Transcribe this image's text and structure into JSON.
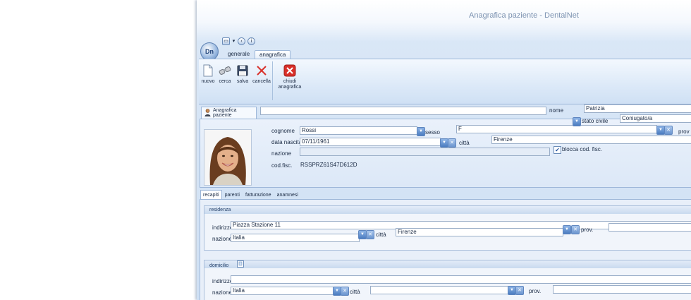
{
  "window": {
    "title": "Anagrafica paziente - DentalNet",
    "logo_text": "Dn"
  },
  "ribbon": {
    "tabs": [
      "generale",
      "anagrafica"
    ],
    "buttons": [
      {
        "label": "nuovo",
        "icon": "new-document-icon"
      },
      {
        "label": "cerca",
        "icon": "binoculars-icon"
      },
      {
        "label": "salva",
        "icon": "floppy-disk-icon"
      },
      {
        "label": "cancella",
        "icon": "delete-x-icon"
      }
    ],
    "close_button": {
      "label_line1": "chiudi",
      "label_line2": "anagrafica",
      "icon": "close-red-icon"
    }
  },
  "patient_tab": "Anagrafica paziente",
  "patient": {
    "nome_label": "nome",
    "nome": "Patrizia",
    "cognome_label": "cognome",
    "cognome": "Rossi",
    "data_nascita_label": "data nascita",
    "data_nascita": "07/11/1961",
    "nazione_label": "nazione",
    "nazione": "",
    "cod_fisc_label": "cod.fisc.",
    "cod_fisc": "RSSPRZ61S47D612D",
    "sesso_label": "sesso",
    "sesso": "F",
    "stato_civile_label": "stato civile",
    "stato_civile": "Coniugato/a",
    "prov_label": "prov",
    "citta_label": "città",
    "citta": "Firenze",
    "blocca_label": "blocca cod. fisc.",
    "blocca_checked": true
  },
  "subtabs": [
    "recapiti",
    "parenti",
    "fatturazione",
    "anamnesi"
  ],
  "residenza": {
    "title": "residenza",
    "indirizzo_label": "indirizzo",
    "indirizzo": "Piazza Stazione 11",
    "nazione_label": "nazione",
    "nazione": "Italia",
    "citta_label": "città",
    "citta": "Firenze",
    "prov_label": "prov.",
    "prov": ""
  },
  "domicilio": {
    "title": "domicilio",
    "indirizzo_label": "indirizzo",
    "indirizzo": "",
    "nazione_label": "nazione",
    "nazione": "Italia",
    "citta_label": "città",
    "citta": "",
    "prov_label": "prov.",
    "prov": ""
  },
  "colors": {
    "accent": "#4b7cc0",
    "panel": "#dce8f7",
    "close_red": "#d9302a"
  }
}
